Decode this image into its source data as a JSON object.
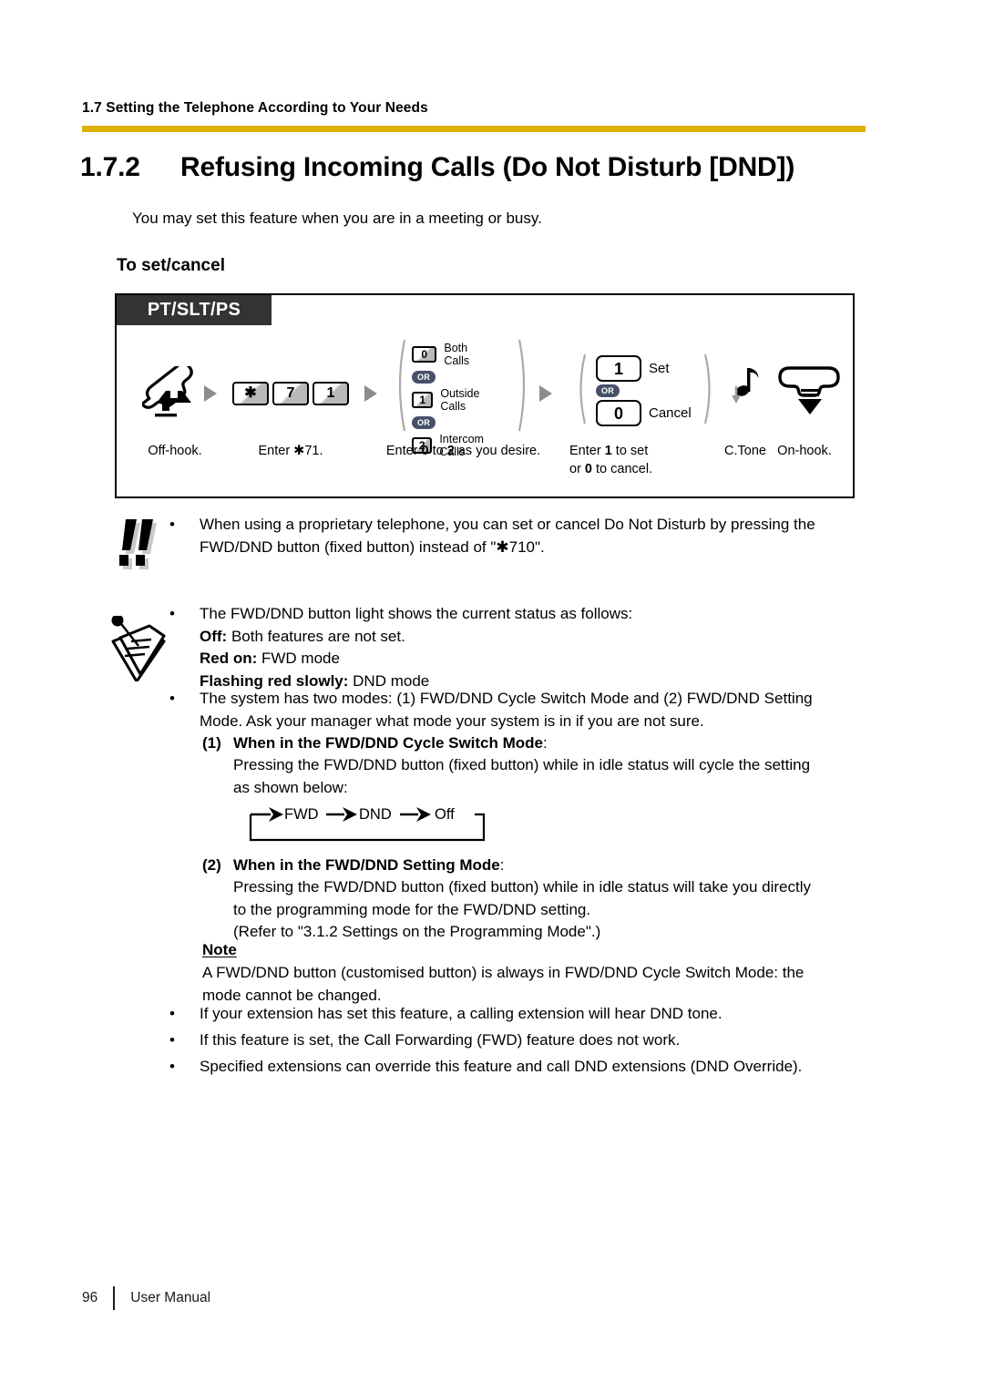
{
  "header": {
    "running_head": "1.7 Setting the Telephone According to Your Needs",
    "rule_color": "#e0b000"
  },
  "title": {
    "number": "1.7.2",
    "text": "Refusing Incoming Calls (Do Not Disturb [DND])"
  },
  "intro": "You may set this feature when you are in a meeting or busy.",
  "subhead": "To set/cancel",
  "procedure": {
    "badge": "PT/SLT/PS",
    "steps": [
      {
        "caption": "Off-hook.",
        "icon": "handset-offhook-icon"
      },
      {
        "caption_html": "Enter ✱71.",
        "caption": "Enter ✱71.",
        "keys": [
          "✱",
          "7",
          "1"
        ]
      },
      {
        "caption": "Enter 0 to 2 as you desire.",
        "caption_prefix": "Enter ",
        "caption_b1": "0",
        "caption_mid": " to ",
        "caption_b2": "2",
        "caption_suffix": " as you desire.",
        "options": [
          {
            "key": "0",
            "label": "Both Calls"
          },
          {
            "or": "OR"
          },
          {
            "key": "1",
            "label": "Outside Calls"
          },
          {
            "or": "OR"
          },
          {
            "key": "2",
            "label": "Intercom Calls"
          }
        ]
      },
      {
        "caption_line1_prefix": "Enter ",
        "caption_line1_b": "1",
        "caption_line1_suffix": " to set",
        "caption_line2_prefix": "or ",
        "caption_line2_b": "0",
        "caption_line2_suffix": " to cancel.",
        "options": [
          {
            "key": "1",
            "label": "Set"
          },
          {
            "or": "OR"
          },
          {
            "key": "0",
            "label": "Cancel"
          }
        ]
      },
      {
        "caption": "C.Tone",
        "icon": "confirmation-tone-icon"
      },
      {
        "caption": "On-hook.",
        "icon": "handset-onhook-icon"
      }
    ]
  },
  "notes": {
    "warning": {
      "icon": "double-exclamation-icon",
      "bullet": "•",
      "line1": "When using a proprietary telephone, you can set or cancel Do Not Disturb by pressing the",
      "line2": "FWD/DND button (fixed button) instead of \"✱710\"."
    },
    "note": {
      "icon": "notepad-pen-icon",
      "bullet": "•",
      "b1_line": "The FWD/DND button light shows the current status as follows:",
      "status": [
        {
          "label": "Off:",
          "text": " Both features are not set."
        },
        {
          "label": "Red on:",
          "text": " FWD mode"
        },
        {
          "label": "Flashing red slowly:",
          "text": " DND mode"
        }
      ],
      "b2_line1": "The system has two modes: (1) FWD/DND Cycle Switch Mode and (2) FWD/DND Setting",
      "b2_line2": "Mode. Ask your manager what mode your system is in if you are not sure.",
      "mode1": {
        "number": "(1)",
        "heading": "When in the FWD/DND Cycle Switch Mode",
        "colon": ":",
        "body_line1": "Pressing the FWD/DND button (fixed button) while in idle status will cycle the setting",
        "body_line2": "as shown below:",
        "cycle": [
          "FWD",
          "DND",
          "Off"
        ]
      },
      "mode2": {
        "number": "(2)",
        "heading": "When in the FWD/DND Setting Mode",
        "colon": ":",
        "body_line1": "Pressing the FWD/DND button (fixed button) while in idle status will take you directly",
        "body_line2": "to the programming mode for the FWD/DND setting.",
        "body_line3": "(Refer to \"3.1.2 Settings on the Programming Mode\".)"
      },
      "note_title": "Note",
      "note_line1": "A FWD/DND button (customised button) is always in FWD/DND Cycle Switch Mode: the",
      "note_line2": "mode cannot be changed.",
      "tail_bullets": [
        "If your extension has set this feature, a calling extension will hear DND tone.",
        "If this feature is set, the Call Forwarding (FWD) feature does not work.",
        "Specified extensions can override this feature and call DND extensions (DND Override)."
      ]
    }
  },
  "footer": {
    "page_number": "96",
    "doc_name": "User Manual"
  }
}
